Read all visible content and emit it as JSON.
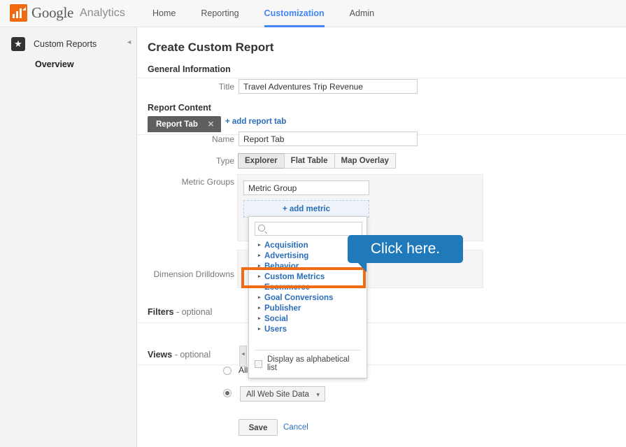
{
  "header": {
    "logo_google": "Google",
    "logo_analytics": "Analytics",
    "nav": [
      {
        "label": "Home",
        "active": false
      },
      {
        "label": "Reporting",
        "active": false
      },
      {
        "label": "Customization",
        "active": true
      },
      {
        "label": "Admin",
        "active": false
      }
    ],
    "accent_color": "#4285f4"
  },
  "sidebar": {
    "item_label": "Custom Reports",
    "sub_label": "Overview",
    "collapse_glyph": "◄"
  },
  "main": {
    "page_title": "Create Custom Report",
    "general_information": {
      "heading": "General Information",
      "title_label": "Title",
      "title_value": "Travel Adventures Trip Revenue"
    },
    "report_content": {
      "heading": "Report Content",
      "tab_chip_label": "Report Tab",
      "tab_chip_close": "✕",
      "add_report_tab": "+ add report tab",
      "name_label": "Name",
      "name_value": "Report Tab",
      "type_label": "Type",
      "type_options": [
        {
          "label": "Explorer",
          "selected": true
        },
        {
          "label": "Flat Table",
          "selected": false
        },
        {
          "label": "Map Overlay",
          "selected": false
        }
      ],
      "metric_groups_label": "Metric Groups",
      "metric_group_value": "Metric Group",
      "add_metric_label": "+ add metric",
      "dimension_drilldowns_label": "Dimension Drilldowns"
    },
    "filters": {
      "heading": "Filters",
      "optional": " - optional"
    },
    "views": {
      "heading": "Views",
      "optional": " - optional",
      "radio_all_label": "All",
      "select_value": "All Web Site Data",
      "select_caret": "▾"
    },
    "actions": {
      "save_label": "Save",
      "cancel_label": "Cancel"
    }
  },
  "dropdown": {
    "search_placeholder": "",
    "search_value": "",
    "items": [
      "Acquisition",
      "Advertising",
      "Behavior",
      "Custom Metrics",
      "Ecommerce",
      "Goal Conversions",
      "Publisher",
      "Social",
      "Users"
    ],
    "caret_glyph": "▸",
    "footer_checkbox_label": "Display as alphabetical list",
    "footer_checkbox_checked": false,
    "link_color": "#2a6ebb"
  },
  "annotation": {
    "callout_text": "Click here.",
    "callout_color": "#2079b8",
    "highlight_color": "#ef6c14",
    "highlight_target": "Custom Metrics"
  }
}
